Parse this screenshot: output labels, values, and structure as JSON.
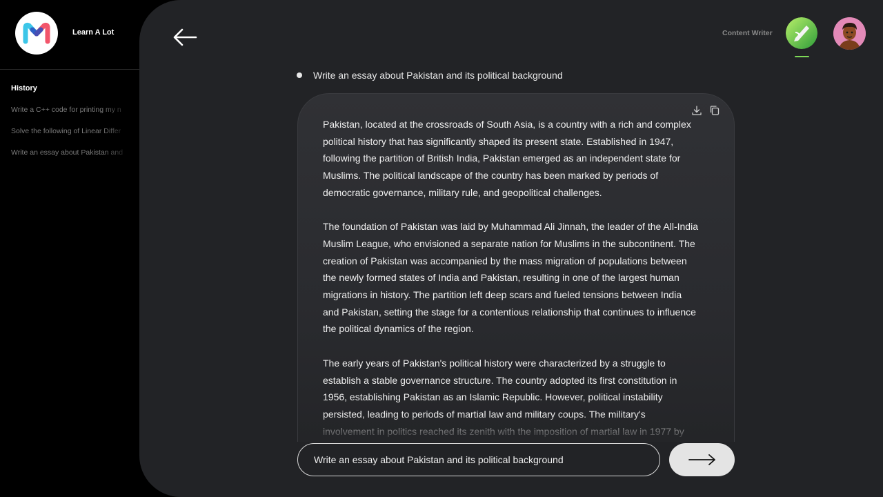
{
  "brand": {
    "name": "Learn A Lot",
    "logo": "learn-a-lot-logo"
  },
  "sidebar": {
    "history_title": "History",
    "items": [
      {
        "label": "Write a C++ code for printing my n"
      },
      {
        "label": "Solve the following of Linear Differ"
      },
      {
        "label": "Write an essay about Pakistan and"
      }
    ]
  },
  "header": {
    "back_icon": "arrow-left-icon",
    "role_label": "Content Writer",
    "role_icon": "content-writer-avatar",
    "user_icon": "user-avatar"
  },
  "prompt": {
    "text": "Write an essay about Pakistan and its political background"
  },
  "answer": {
    "icons": [
      "download-icon",
      "copy-icon"
    ],
    "paragraphs": [
      "Pakistan, located at the crossroads of South Asia, is a country with a rich and complex political history that has significantly shaped its present state. Established in 1947, following the partition of British India, Pakistan emerged as an independent state for Muslims. The political landscape of the country has been marked by periods of democratic governance, military rule, and geopolitical challenges.",
      "The foundation of Pakistan was laid by Muhammad Ali Jinnah, the leader of the All-India Muslim League, who envisioned a separate nation for Muslims in the subcontinent. The creation of Pakistan was accompanied by the mass migration of populations between the newly formed states of India and Pakistan, resulting in one of the largest human migrations in history. The partition left deep scars and fueled tensions between India and Pakistan, setting the stage for a contentious relationship that continues to influence the political dynamics of the region.",
      "The early years of Pakistan's political history were characterized by a struggle to establish a stable governance structure. The country adopted its first constitution in 1956, establishing Pakistan as an Islamic Republic. However, political instability persisted, leading to periods of martial law and military coups. The military's involvement in politics reached its zenith with the imposition of martial law in 1977 by"
    ]
  },
  "input": {
    "value": "Write an essay about Pakistan and its political background"
  },
  "send": {
    "icon": "arrow-right-icon"
  },
  "colors": {
    "background": "#000000",
    "panel": "#222326",
    "accent_green": "#7ed957",
    "send_button": "#e4e4e4"
  }
}
